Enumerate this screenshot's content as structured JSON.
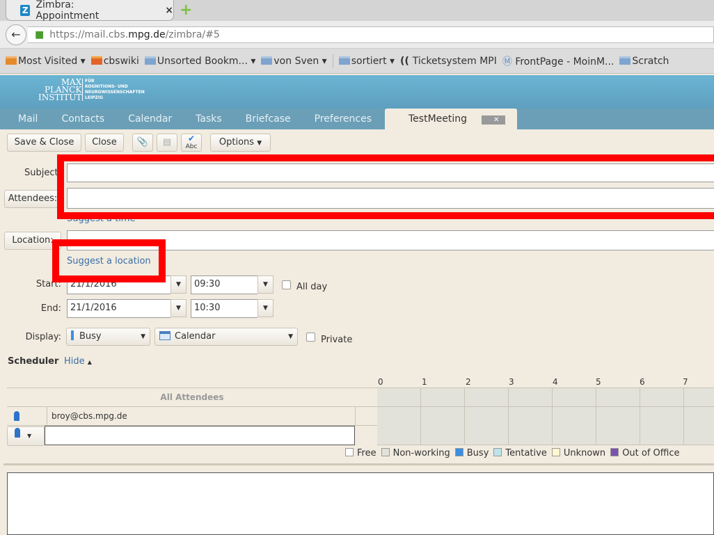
{
  "browser": {
    "tab_title": "Zimbra: Appointment",
    "url_prefix": "https://mail.cbs.",
    "url_domain": "mpg.de",
    "url_suffix": "/zimbra/#5",
    "bookmarks": [
      "Most Visited ▾",
      "cbswiki",
      "Unsorted Bookm... ▾",
      "von Sven ▾",
      "sortiert ▾",
      "Ticketsystem MPI",
      "FrontPage - MoinM...",
      "Scratch"
    ]
  },
  "logo": {
    "line1": "MAX",
    "line2": "PLANCK",
    "line3": "INSTITUT",
    "sub1": "FÜR",
    "sub2": "KOGNITIONS- UND",
    "sub3": "NEUROWISSENSCHAFTEN",
    "sub4": "LEIPZIG"
  },
  "nav": {
    "items": [
      "Mail",
      "Contacts",
      "Calendar",
      "Tasks",
      "Briefcase",
      "Preferences"
    ],
    "active": "TestMeeting"
  },
  "toolbar": {
    "save_close": "Save & Close",
    "close": "Close",
    "spell": "Abc",
    "options": "Options"
  },
  "form": {
    "subject_label": "Subject:",
    "subject_value": "",
    "attendees_label": "Attendees:",
    "attendees_value": "",
    "suggest_time": "Suggest a time",
    "location_label": "Location:",
    "location_value": "",
    "suggest_location": "Suggest a location",
    "start_label": "Start:",
    "start_date": "21/1/2016",
    "start_time": "09:30",
    "all_day": "All day",
    "end_label": "End:",
    "end_date": "21/1/2016",
    "end_time": "10:30",
    "display_label": "Display:",
    "display_value": "Busy",
    "calendar_value": "Calendar",
    "private": "Private"
  },
  "scheduler": {
    "title": "Scheduler",
    "hide": "Hide",
    "hours": [
      "0",
      "1",
      "2",
      "3",
      "4",
      "5",
      "6",
      "7"
    ],
    "all_attendees": "All Attendees",
    "attendee": "broy@cbs.mpg.de",
    "legend": [
      {
        "label": "Free",
        "color": "#ffffff"
      },
      {
        "label": "Non-working",
        "color": "#e3e2da"
      },
      {
        "label": "Busy",
        "color": "#3b8fe0"
      },
      {
        "label": "Tentative",
        "color": "#bfe3ea"
      },
      {
        "label": "Unknown",
        "color": "#fff7d0"
      },
      {
        "label": "Out of Office",
        "color": "#7b53ae"
      }
    ]
  },
  "colors": {
    "highlight": "#ff0000",
    "link": "#3c6ea6"
  }
}
